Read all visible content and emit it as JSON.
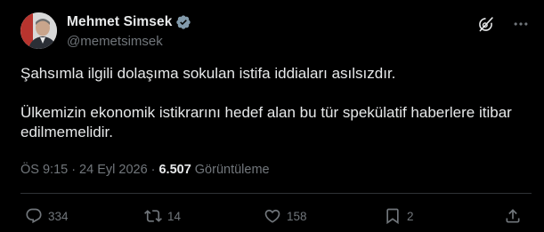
{
  "author": {
    "display_name": "Mehmet Simsek",
    "handle": "@memetsimsek",
    "verified": true
  },
  "tweet": {
    "paragraphs": [
      "Şahsımla ilgili dolaşıma sokulan istifa iddiaları asılsızdır.",
      "Ülkemizin ekonomik istikrarını hedef alan bu tür spekülatif haberlere itibar edilmemelidir."
    ]
  },
  "meta": {
    "time": "ÖS 9:15",
    "separator": "·",
    "date": "24 Eyl 2026",
    "views_count": "6.507",
    "views_label": "Görüntüleme"
  },
  "actions": {
    "replies": "334",
    "retweets": "14",
    "likes": "158",
    "bookmarks": "2"
  },
  "colors": {
    "background": "#000000",
    "text_primary": "#e7e9ea",
    "text_secondary": "#71767b",
    "verified_badge": "#829aab",
    "divider": "#2f3336"
  },
  "icons": {
    "top_right": [
      "grok-icon",
      "more-icon"
    ],
    "action_bar": [
      "reply-icon",
      "retweet-icon",
      "like-icon",
      "bookmark-icon",
      "share-icon"
    ]
  }
}
